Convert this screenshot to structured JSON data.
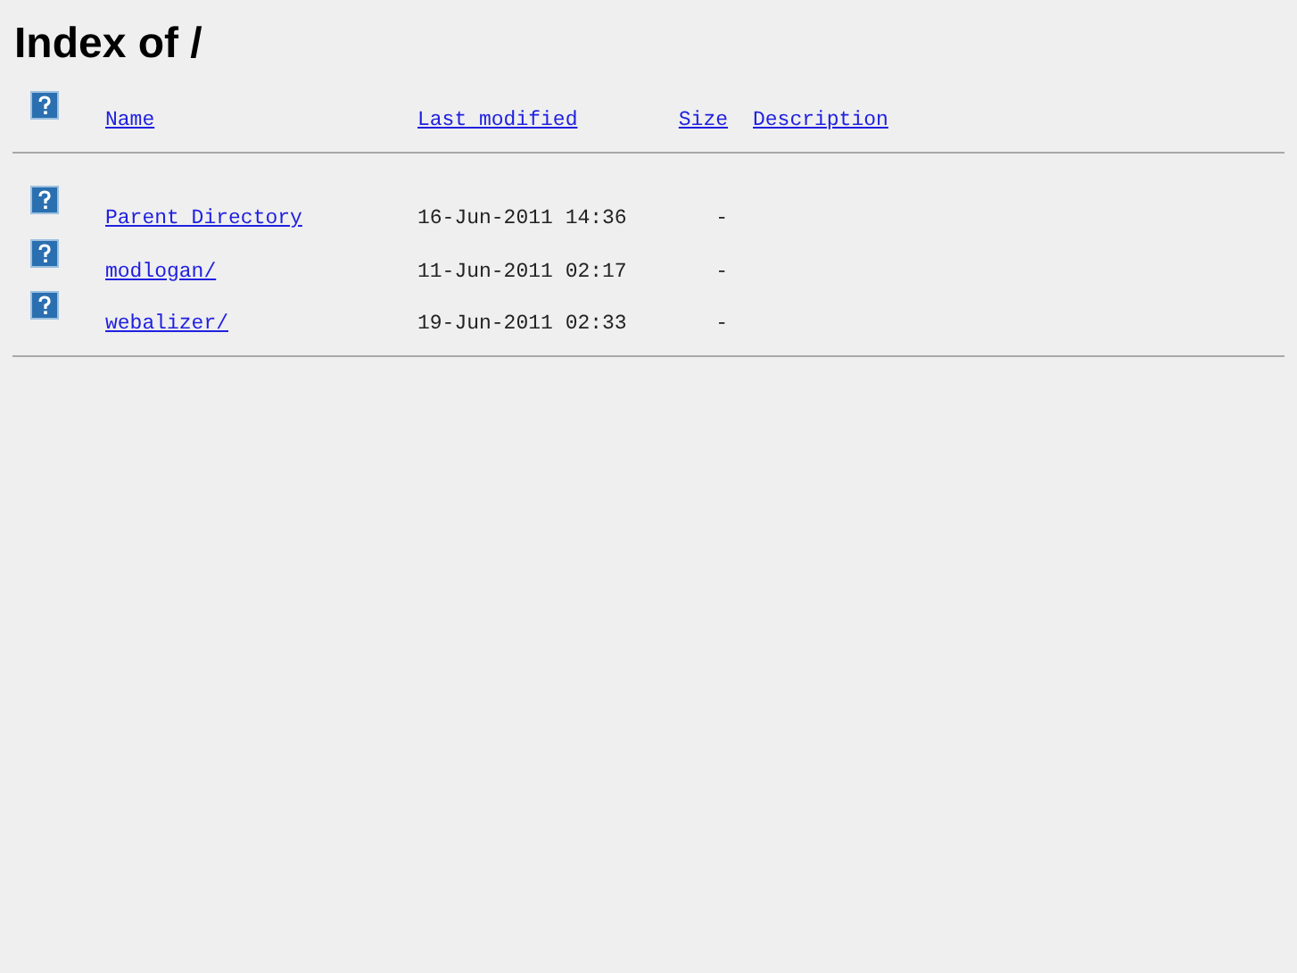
{
  "title": "Index of /",
  "columns": [
    "Name",
    "Last modified",
    "Size",
    "Description"
  ],
  "rows": [
    {
      "name": "Parent Directory",
      "modified": "16-Jun-2011 14:36",
      "size": "-"
    },
    {
      "name": "modlogan/",
      "modified": "11-Jun-2011 02:17",
      "size": "-"
    },
    {
      "name": "webalizer/",
      "modified": "19-Jun-2011 02:33",
      "size": "-"
    }
  ]
}
